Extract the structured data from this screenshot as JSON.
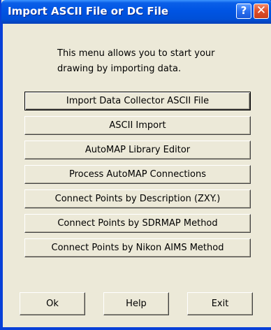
{
  "window": {
    "title": "Import ASCII File or DC File",
    "help_glyph": "?",
    "close_glyph": "✕"
  },
  "intro": {
    "line1": "This menu allows you to start your",
    "line2": "drawing by importing data."
  },
  "actions": [
    {
      "label": "Import Data Collector ASCII File"
    },
    {
      "label": "ASCII Import"
    },
    {
      "label": "AutoMAP Library Editor"
    },
    {
      "label": "Process AutoMAP Connections"
    },
    {
      "label": "Connect Points by Description (ZXY.)"
    },
    {
      "label": "Connect Points by SDRMAP Method"
    },
    {
      "label": "Connect Points by Nikon AIMS Method"
    }
  ],
  "footer": {
    "ok_label": "Ok",
    "help_label": "Help",
    "exit_label": "Exit"
  },
  "colors": {
    "titlebar": "#0054e3",
    "dialog_bg": "#ece9d8",
    "close_button": "#e0502c"
  },
  "icons": {
    "help": "help-icon",
    "close": "close-icon"
  }
}
